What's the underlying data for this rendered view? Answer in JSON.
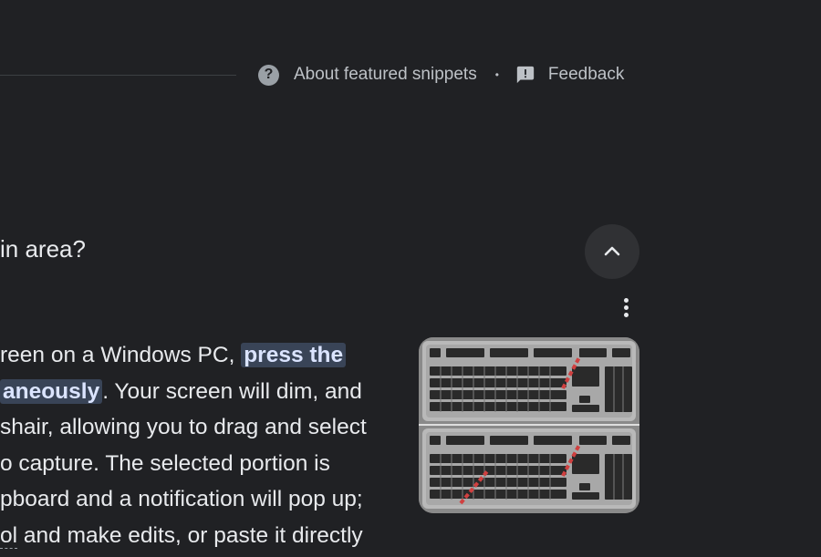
{
  "meta": {
    "about_label": "About featured snippets",
    "separator": "•",
    "feedback_label": "Feedback",
    "question_icon_glyph": "?"
  },
  "question": {
    "text": "in area?"
  },
  "answer": {
    "line1_before": "reen on a Windows PC, ",
    "line1_highlight": "press the",
    "line2_highlight": "aneously",
    "line2_after": ". Your screen will dim, and",
    "line3": "shair, allowing you to drag and select",
    "line4": "o capture. The selected portion is",
    "line5": "pboard and a notification will pop up;",
    "line6_term": "ol",
    "line6_after": " and make edits, or paste it directly"
  },
  "icons": {
    "about": "help-circle-icon",
    "feedback": "feedback-icon",
    "collapse": "chevron-up-icon",
    "more": "more-vert-icon"
  },
  "colors": {
    "background": "#202124",
    "text": "#e8eaed",
    "secondary_text": "#bdc1c6",
    "highlight_bg": "#394457",
    "button_bg": "#303134"
  }
}
